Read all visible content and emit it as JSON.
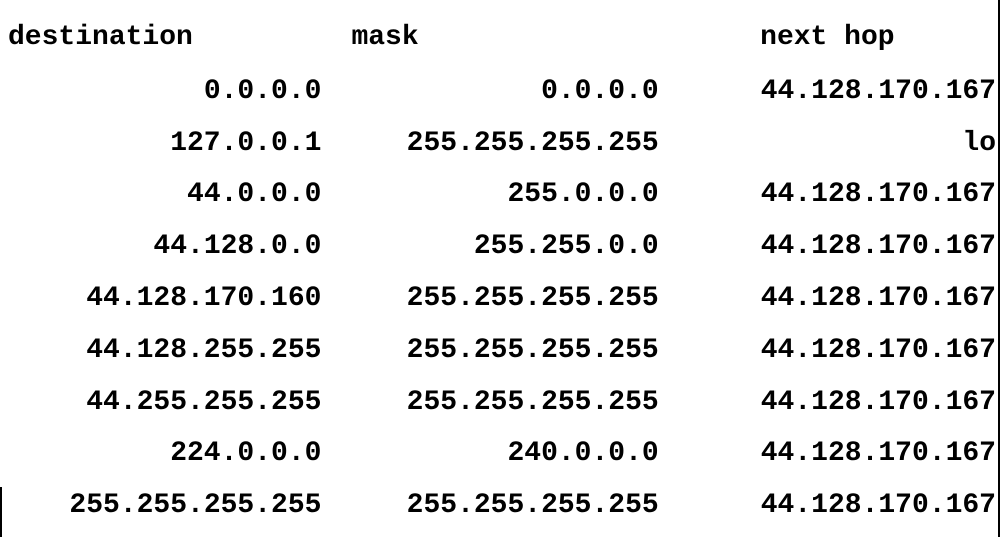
{
  "headers": {
    "destination": "destination",
    "mask": "mask",
    "next_hop": "next hop"
  },
  "rows": [
    {
      "destination": "0.0.0.0",
      "mask": "0.0.0.0",
      "next_hop": "44.128.170.167"
    },
    {
      "destination": "127.0.0.1",
      "mask": "255.255.255.255",
      "next_hop": "lo"
    },
    {
      "destination": "44.0.0.0",
      "mask": "255.0.0.0",
      "next_hop": "44.128.170.167"
    },
    {
      "destination": "44.128.0.0",
      "mask": "255.255.0.0",
      "next_hop": "44.128.170.167"
    },
    {
      "destination": "44.128.170.160",
      "mask": "255.255.255.255",
      "next_hop": "44.128.170.167"
    },
    {
      "destination": "44.128.255.255",
      "mask": "255.255.255.255",
      "next_hop": "44.128.170.167"
    },
    {
      "destination": "44.255.255.255",
      "mask": "255.255.255.255",
      "next_hop": "44.128.170.167"
    },
    {
      "destination": "224.0.0.0",
      "mask": "240.0.0.0",
      "next_hop": "44.128.170.167"
    },
    {
      "destination": "255.255.255.255",
      "mask": "255.255.255.255",
      "next_hop": "44.128.170.167"
    }
  ]
}
